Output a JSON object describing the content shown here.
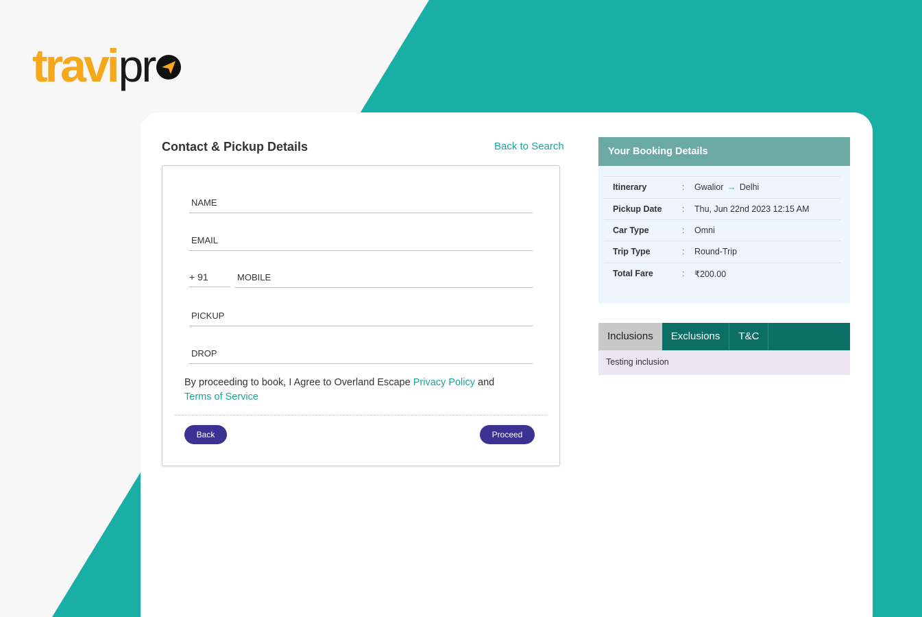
{
  "brand": {
    "name_part1": "travi",
    "name_part2": "pr",
    "accent": "#f6a81c",
    "teal": "#1aafa6"
  },
  "contact": {
    "title": "Contact & Pickup Details",
    "back_to_search": "Back to Search",
    "fields": {
      "name_placeholder": "NAME",
      "email_placeholder": "EMAIL",
      "country_code": "+ 91",
      "mobile_placeholder": "MOBILE",
      "pickup_placeholder": "PICKUP",
      "drop_placeholder": "DROP"
    },
    "agree_text": "By proceeding to book, I Agree to Overland Escape",
    "privacy_link": "Privacy Policy",
    "and_text": "and",
    "terms_link": "Terms of Service",
    "back_button": "Back",
    "proceed_button": "Proceed"
  },
  "booking": {
    "title": "Your Booking Details",
    "separator": ":",
    "rows": [
      {
        "key": "Itinerary",
        "from": "Gwalior",
        "to": "Delhi"
      },
      {
        "key": "Pickup Date",
        "value": "Thu, Jun 22nd 2023 12:15 AM"
      },
      {
        "key": "Car Type",
        "value": "Omni"
      },
      {
        "key": "Trip Type",
        "value": "Round-Trip"
      },
      {
        "key": "Total Fare",
        "value": "₹200.00"
      }
    ]
  },
  "tabs": {
    "items": [
      {
        "label": "Inclusions"
      },
      {
        "label": "Exclusions"
      },
      {
        "label": "T&C"
      }
    ],
    "active_index": 0,
    "content": "Testing inclusion"
  },
  "icons": {
    "logo_mark": "navigation-arrow-icon",
    "itinerary_arrow": "arrow-right-icon"
  }
}
